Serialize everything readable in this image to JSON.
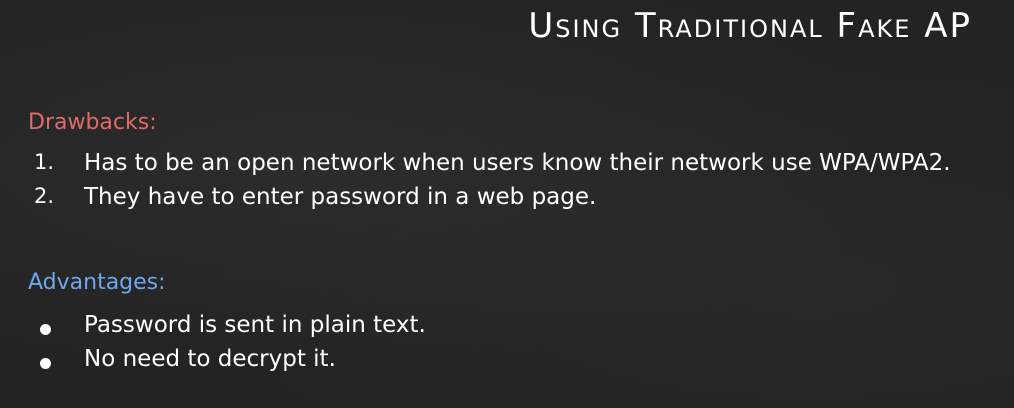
{
  "slide": {
    "title": "Using Traditional Fake AP",
    "drawbacks": {
      "heading": "Drawbacks:",
      "color": "#e06a6a",
      "items": [
        {
          "marker": "1.",
          "text": "Has to be an open network when users know their network use WPA/WPA2."
        },
        {
          "marker": "2.",
          "text": "They have to enter password in a web page."
        }
      ]
    },
    "advantages": {
      "heading": "Advantages:",
      "color": "#6ea6ef",
      "bullet_icon": "bullet-dot",
      "items": [
        {
          "text": "Password is sent in plain text."
        },
        {
          "text": "No need to decrypt it."
        }
      ]
    }
  }
}
